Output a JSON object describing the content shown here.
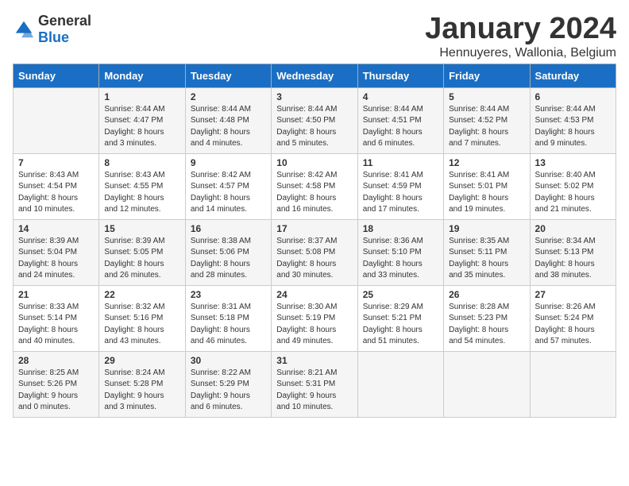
{
  "logo": {
    "general": "General",
    "blue": "Blue"
  },
  "title": "January 2024",
  "subtitle": "Hennuyeres, Wallonia, Belgium",
  "days_of_week": [
    "Sunday",
    "Monday",
    "Tuesday",
    "Wednesday",
    "Thursday",
    "Friday",
    "Saturday"
  ],
  "weeks": [
    [
      {
        "day": "",
        "info": ""
      },
      {
        "day": "1",
        "info": "Sunrise: 8:44 AM\nSunset: 4:47 PM\nDaylight: 8 hours\nand 3 minutes."
      },
      {
        "day": "2",
        "info": "Sunrise: 8:44 AM\nSunset: 4:48 PM\nDaylight: 8 hours\nand 4 minutes."
      },
      {
        "day": "3",
        "info": "Sunrise: 8:44 AM\nSunset: 4:50 PM\nDaylight: 8 hours\nand 5 minutes."
      },
      {
        "day": "4",
        "info": "Sunrise: 8:44 AM\nSunset: 4:51 PM\nDaylight: 8 hours\nand 6 minutes."
      },
      {
        "day": "5",
        "info": "Sunrise: 8:44 AM\nSunset: 4:52 PM\nDaylight: 8 hours\nand 7 minutes."
      },
      {
        "day": "6",
        "info": "Sunrise: 8:44 AM\nSunset: 4:53 PM\nDaylight: 8 hours\nand 9 minutes."
      }
    ],
    [
      {
        "day": "7",
        "info": "Sunrise: 8:43 AM\nSunset: 4:54 PM\nDaylight: 8 hours\nand 10 minutes."
      },
      {
        "day": "8",
        "info": "Sunrise: 8:43 AM\nSunset: 4:55 PM\nDaylight: 8 hours\nand 12 minutes."
      },
      {
        "day": "9",
        "info": "Sunrise: 8:42 AM\nSunset: 4:57 PM\nDaylight: 8 hours\nand 14 minutes."
      },
      {
        "day": "10",
        "info": "Sunrise: 8:42 AM\nSunset: 4:58 PM\nDaylight: 8 hours\nand 16 minutes."
      },
      {
        "day": "11",
        "info": "Sunrise: 8:41 AM\nSunset: 4:59 PM\nDaylight: 8 hours\nand 17 minutes."
      },
      {
        "day": "12",
        "info": "Sunrise: 8:41 AM\nSunset: 5:01 PM\nDaylight: 8 hours\nand 19 minutes."
      },
      {
        "day": "13",
        "info": "Sunrise: 8:40 AM\nSunset: 5:02 PM\nDaylight: 8 hours\nand 21 minutes."
      }
    ],
    [
      {
        "day": "14",
        "info": "Sunrise: 8:39 AM\nSunset: 5:04 PM\nDaylight: 8 hours\nand 24 minutes."
      },
      {
        "day": "15",
        "info": "Sunrise: 8:39 AM\nSunset: 5:05 PM\nDaylight: 8 hours\nand 26 minutes."
      },
      {
        "day": "16",
        "info": "Sunrise: 8:38 AM\nSunset: 5:06 PM\nDaylight: 8 hours\nand 28 minutes."
      },
      {
        "day": "17",
        "info": "Sunrise: 8:37 AM\nSunset: 5:08 PM\nDaylight: 8 hours\nand 30 minutes."
      },
      {
        "day": "18",
        "info": "Sunrise: 8:36 AM\nSunset: 5:10 PM\nDaylight: 8 hours\nand 33 minutes."
      },
      {
        "day": "19",
        "info": "Sunrise: 8:35 AM\nSunset: 5:11 PM\nDaylight: 8 hours\nand 35 minutes."
      },
      {
        "day": "20",
        "info": "Sunrise: 8:34 AM\nSunset: 5:13 PM\nDaylight: 8 hours\nand 38 minutes."
      }
    ],
    [
      {
        "day": "21",
        "info": "Sunrise: 8:33 AM\nSunset: 5:14 PM\nDaylight: 8 hours\nand 40 minutes."
      },
      {
        "day": "22",
        "info": "Sunrise: 8:32 AM\nSunset: 5:16 PM\nDaylight: 8 hours\nand 43 minutes."
      },
      {
        "day": "23",
        "info": "Sunrise: 8:31 AM\nSunset: 5:18 PM\nDaylight: 8 hours\nand 46 minutes."
      },
      {
        "day": "24",
        "info": "Sunrise: 8:30 AM\nSunset: 5:19 PM\nDaylight: 8 hours\nand 49 minutes."
      },
      {
        "day": "25",
        "info": "Sunrise: 8:29 AM\nSunset: 5:21 PM\nDaylight: 8 hours\nand 51 minutes."
      },
      {
        "day": "26",
        "info": "Sunrise: 8:28 AM\nSunset: 5:23 PM\nDaylight: 8 hours\nand 54 minutes."
      },
      {
        "day": "27",
        "info": "Sunrise: 8:26 AM\nSunset: 5:24 PM\nDaylight: 8 hours\nand 57 minutes."
      }
    ],
    [
      {
        "day": "28",
        "info": "Sunrise: 8:25 AM\nSunset: 5:26 PM\nDaylight: 9 hours\nand 0 minutes."
      },
      {
        "day": "29",
        "info": "Sunrise: 8:24 AM\nSunset: 5:28 PM\nDaylight: 9 hours\nand 3 minutes."
      },
      {
        "day": "30",
        "info": "Sunrise: 8:22 AM\nSunset: 5:29 PM\nDaylight: 9 hours\nand 6 minutes."
      },
      {
        "day": "31",
        "info": "Sunrise: 8:21 AM\nSunset: 5:31 PM\nDaylight: 9 hours\nand 10 minutes."
      },
      {
        "day": "",
        "info": ""
      },
      {
        "day": "",
        "info": ""
      },
      {
        "day": "",
        "info": ""
      }
    ]
  ]
}
